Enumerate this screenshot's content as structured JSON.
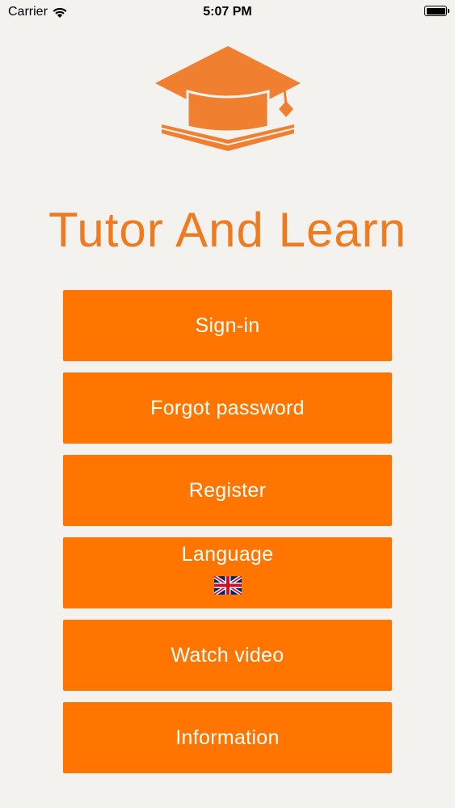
{
  "status_bar": {
    "carrier": "Carrier",
    "time": "5:07 PM"
  },
  "app": {
    "title": "Tutor And Learn",
    "accent_color": "#ff7500",
    "title_color": "#f07a20"
  },
  "menu": {
    "sign_in": "Sign-in",
    "forgot_password": "Forgot password",
    "register": "Register",
    "language": "Language",
    "language_flag": "uk-flag-icon",
    "watch_video": "Watch video",
    "information": "Information"
  }
}
